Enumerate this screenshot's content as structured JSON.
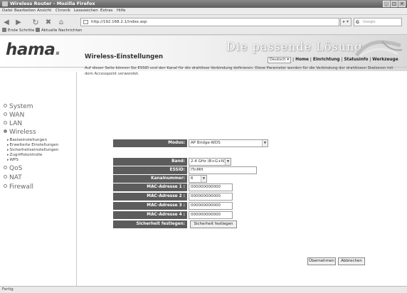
{
  "window": {
    "title": "Wireless Router - Mozilla Firefox",
    "buttons": [
      "_",
      "□",
      "✕"
    ]
  },
  "menubar": [
    "Datei",
    "Bearbeiten",
    "Ansicht",
    "Chronik",
    "Lesezeichen",
    "Extras",
    "Hilfe"
  ],
  "navbar": {
    "url": "http://192.168.2.1/index.asp",
    "search_placeholder": "Google",
    "bookmarks": [
      "Erste Schritte",
      "Aktuelle Nachrichten"
    ]
  },
  "header": {
    "logo": "hama",
    "logo_dot": ".",
    "tagline": "Die passende Lösung",
    "language": "Deutsch",
    "links": [
      "Home",
      "Einrichtung",
      "Statusinfo",
      "Werkzeuge"
    ],
    "separator": "|"
  },
  "sidebar": {
    "items": [
      {
        "label": "System"
      },
      {
        "label": "WAN"
      },
      {
        "label": "LAN"
      },
      {
        "label": "Wireless",
        "selected": true
      },
      {
        "label": "QoS"
      },
      {
        "label": "NAT"
      },
      {
        "label": "Firewall"
      }
    ],
    "wireless_sub": [
      "Basiseinstellungen",
      "Erweiterte Einstellungen",
      "Sicherheitseinstellungen",
      "Zugriffskontrolle",
      "WPS"
    ]
  },
  "main": {
    "title": "Wireless-Einstellungen",
    "description": "Auf dieser Seite können Sie ESSID und den Kanal für die drahtlose Verbindung definieren. Diese Parameter werden für die Verbindung der drahtlosen Stationen mit dem Accesspoint verwendet.",
    "mode_label": "Modus:",
    "mode_value": "AP Bridge-WDS",
    "band_label": "Band:",
    "band_value": "2.4 GHz (B+G+N)",
    "essid_label": "ESSID:",
    "essid_value": "ITnMH",
    "channel_label": "Kanalnummer:",
    "channel_value": "6",
    "mac_labels": [
      "MAC-Adresse 1 :",
      "MAC-Adresse 2 :",
      "MAC-Adresse 3 :",
      "MAC-Adresse 4 :"
    ],
    "mac_values": [
      "000000000000",
      "000000000000",
      "000000000000",
      "000000000000"
    ],
    "security_label": "Sicherheit festlegen:",
    "security_button": "Sicherheit festlegen",
    "apply_button": "Übernehmen",
    "cancel_button": "Abbrechen"
  },
  "statusbar": {
    "text": "Fertig"
  }
}
